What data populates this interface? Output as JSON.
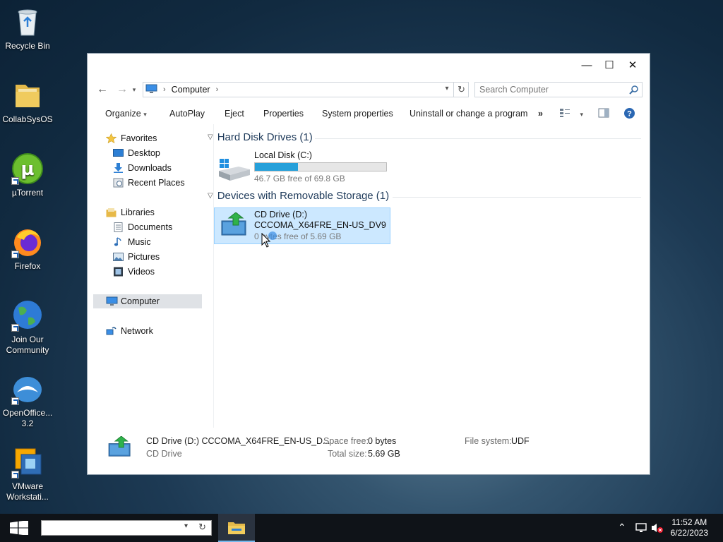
{
  "desktop": {
    "icons": [
      {
        "label": "Recycle Bin",
        "icon": "recycle-bin-icon"
      },
      {
        "label": "CollabSysOS",
        "icon": "folder-icon"
      },
      {
        "label": "µTorrent",
        "icon": "utorrent-icon"
      },
      {
        "label": "Firefox",
        "icon": "firefox-icon"
      },
      {
        "label": "Join Our Community",
        "icon": "globe-icon"
      },
      {
        "label": "OpenOffice... 3.2",
        "icon": "openoffice-icon"
      },
      {
        "label": "VMware Workstati...",
        "icon": "vmware-icon"
      }
    ]
  },
  "window": {
    "controls": {
      "minimize": "—",
      "maximize": "☐",
      "close": "✕"
    },
    "address": {
      "crumb": "Computer"
    },
    "search": {
      "placeholder": "Search Computer"
    },
    "toolbar": {
      "organize": "Organize",
      "autoplay": "AutoPlay",
      "eject": "Eject",
      "properties": "Properties",
      "system_properties": "System properties",
      "uninstall": "Uninstall or change a program",
      "more": "»"
    },
    "nav": {
      "favorites": "Favorites",
      "desktop": "Desktop",
      "downloads": "Downloads",
      "recent_places": "Recent Places",
      "libraries": "Libraries",
      "documents": "Documents",
      "music": "Music",
      "pictures": "Pictures",
      "videos": "Videos",
      "computer": "Computer",
      "network": "Network"
    },
    "groups": {
      "hdd": "Hard Disk Drives (1)",
      "removable": "Devices with Removable Storage (1)"
    },
    "drives": {
      "local": {
        "name": "Local Disk (C:)",
        "free": "46.7 GB free of 69.8 GB",
        "used_fraction": 0.33
      },
      "cd": {
        "name": "CD Drive (D:)",
        "label": "CCCOMA_X64FRE_EN-US_DV9",
        "free": "0 bytes free of 5.69 GB"
      }
    },
    "details": {
      "title": "CD Drive (D:) CCCOMA_X64FRE_EN-US_D...",
      "type": "CD Drive",
      "space_free_label": "Space free:",
      "space_free": "0 bytes",
      "total_size_label": "Total size:",
      "total_size": "5.69 GB",
      "fs_label": "File system:",
      "fs": "UDF"
    }
  },
  "taskbar": {
    "time": "11:52 AM",
    "date": "6/22/2023",
    "colors": {
      "accent": "#26a0da",
      "selection": "#cce8ff"
    }
  }
}
